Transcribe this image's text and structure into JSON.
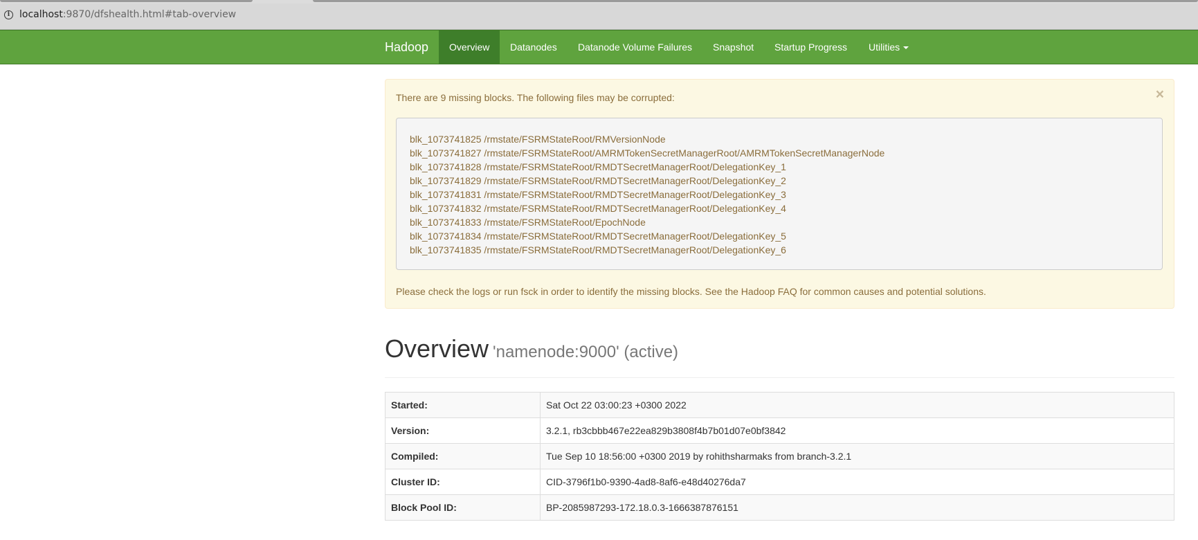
{
  "browser": {
    "url_host": "localhost",
    "url_rest": ":9870/dfshealth.html#tab-overview"
  },
  "navbar": {
    "brand": "Hadoop",
    "items": [
      {
        "label": "Overview",
        "active": true
      },
      {
        "label": "Datanodes"
      },
      {
        "label": "Datanode Volume Failures"
      },
      {
        "label": "Snapshot"
      },
      {
        "label": "Startup Progress"
      },
      {
        "label": "Utilities"
      }
    ]
  },
  "alert": {
    "title": "There are 9 missing blocks. The following files may be corrupted:",
    "close": "×",
    "blocks": [
      "blk_1073741825 /rmstate/FSRMStateRoot/RMVersionNode",
      "blk_1073741827 /rmstate/FSRMStateRoot/AMRMTokenSecretManagerRoot/AMRMTokenSecretManagerNode",
      "blk_1073741828 /rmstate/FSRMStateRoot/RMDTSecretManagerRoot/DelegationKey_1",
      "blk_1073741829 /rmstate/FSRMStateRoot/RMDTSecretManagerRoot/DelegationKey_2",
      "blk_1073741831 /rmstate/FSRMStateRoot/RMDTSecretManagerRoot/DelegationKey_3",
      "blk_1073741832 /rmstate/FSRMStateRoot/RMDTSecretManagerRoot/DelegationKey_4",
      "blk_1073741833 /rmstate/FSRMStateRoot/EpochNode",
      "blk_1073741834 /rmstate/FSRMStateRoot/RMDTSecretManagerRoot/DelegationKey_5",
      "blk_1073741835 /rmstate/FSRMStateRoot/RMDTSecretManagerRoot/DelegationKey_6"
    ],
    "footer": "Please check the logs or run fsck in order to identify the missing blocks. See the Hadoop FAQ for common causes and potential solutions."
  },
  "overview": {
    "title": "Overview",
    "subtitle": "'namenode:9000' (active)",
    "rows": [
      {
        "key": "Started:",
        "value": "Sat Oct 22 03:00:23 +0300 2022"
      },
      {
        "key": "Version:",
        "value": "3.2.1, rb3cbbb467e22ea829b3808f4b7b01d07e0bf3842"
      },
      {
        "key": "Compiled:",
        "value": "Tue Sep 10 18:56:00 +0300 2019 by rohithsharmaks from branch-3.2.1"
      },
      {
        "key": "Cluster ID:",
        "value": "CID-3796f1b0-9390-4ad8-8af6-e48d40276da7"
      },
      {
        "key": "Block Pool ID:",
        "value": "BP-2085987293-172.18.0.3-1666387876151"
      }
    ]
  }
}
